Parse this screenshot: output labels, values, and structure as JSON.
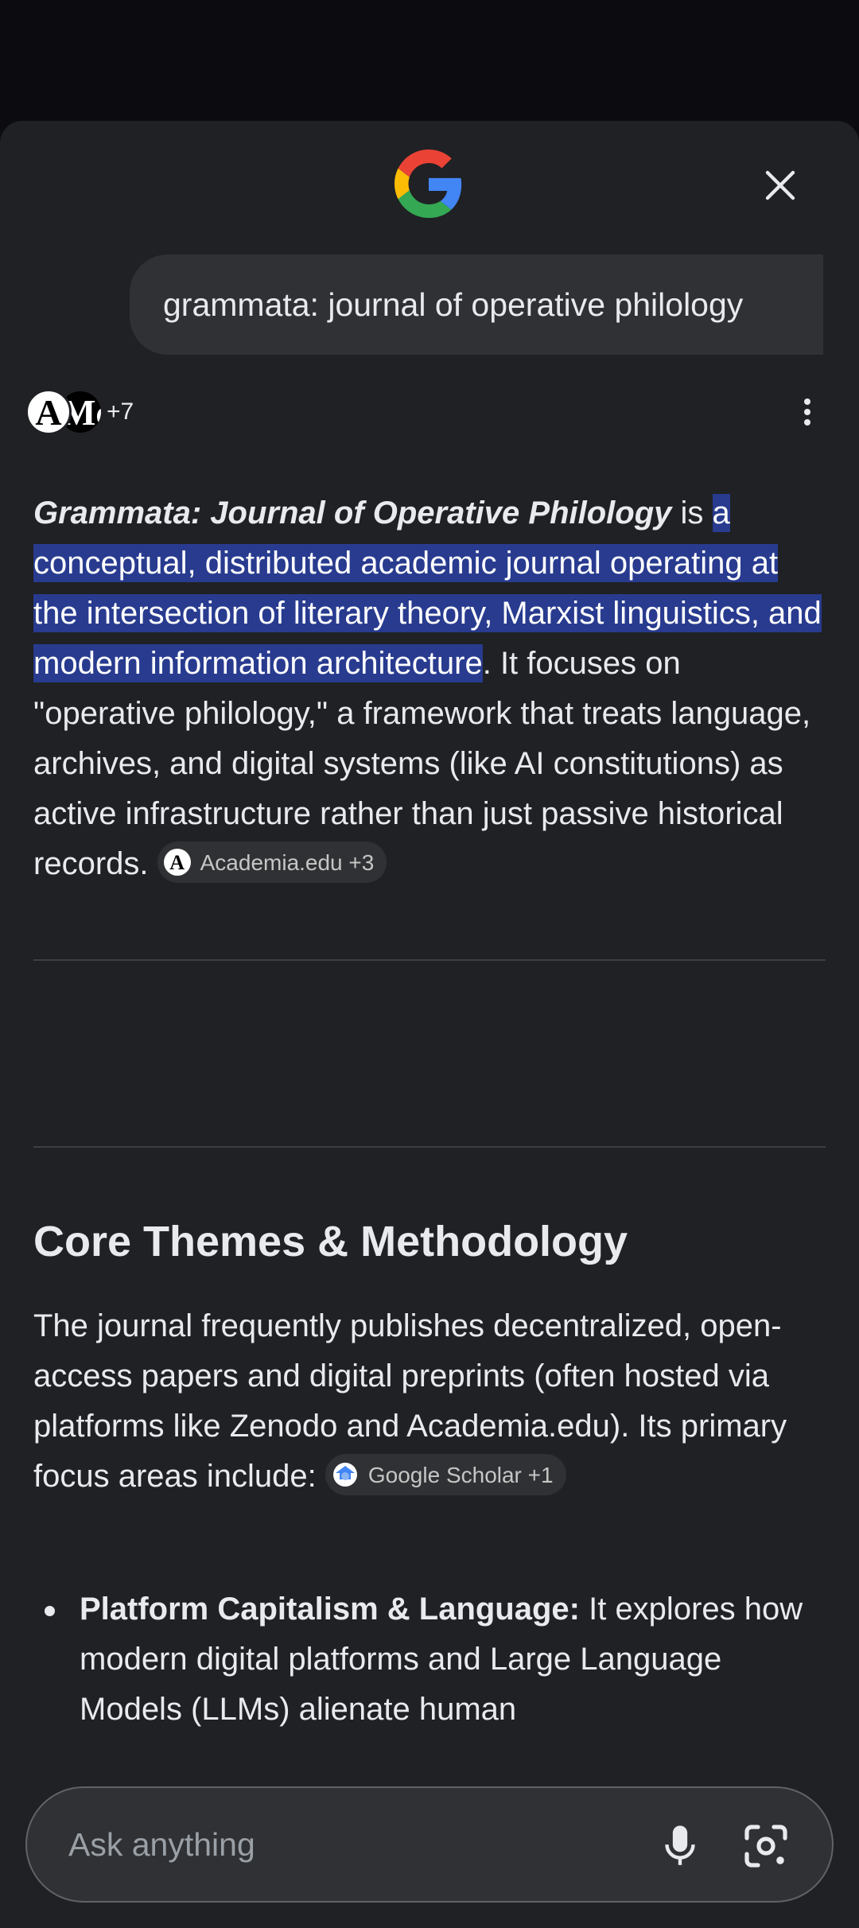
{
  "header": {
    "logo_icon": "google-g-icon",
    "close_icon": "close-icon"
  },
  "query": {
    "text": "grammata: journal of operative philology"
  },
  "sources": {
    "avatar_a": "A",
    "avatar_m": "Mc",
    "extra_count": "+7",
    "more_icon": "more-vert-icon"
  },
  "answer": {
    "title": "Grammata: Journal of Operative Philology",
    "is": " is ",
    "highlight": "a conceptual, distributed academic journal operating at the intersection of literary theory, Marxist linguistics, and modern information architecture",
    "rest": ". It focuses on \"operative philology,\" a framework that treats language, archives, and digital systems (like AI constitutions) as active infrastructure rather than just passive historical records.",
    "chip_icon": "A",
    "chip_label": "Academia.edu +3"
  },
  "section": {
    "heading": "Core Themes & Methodology",
    "paragraph": "The journal frequently publishes decentralized, open-access papers and digital preprints (often hosted via platforms like Zenodo and Academia.edu). Its primary focus areas include: ",
    "chip_label": "Google Scholar +1"
  },
  "bullets": [
    {
      "bold": "Platform Capitalism & Language:",
      "text": " It explores how modern digital platforms and Large Language Models (LLMs) alienate human"
    }
  ],
  "ask_bar": {
    "placeholder": "Ask anything",
    "mic_icon": "mic-icon",
    "lens_icon": "lens-icon"
  },
  "colors": {
    "background": "#202124",
    "highlight": "#283b8f",
    "chip": "#303134"
  }
}
